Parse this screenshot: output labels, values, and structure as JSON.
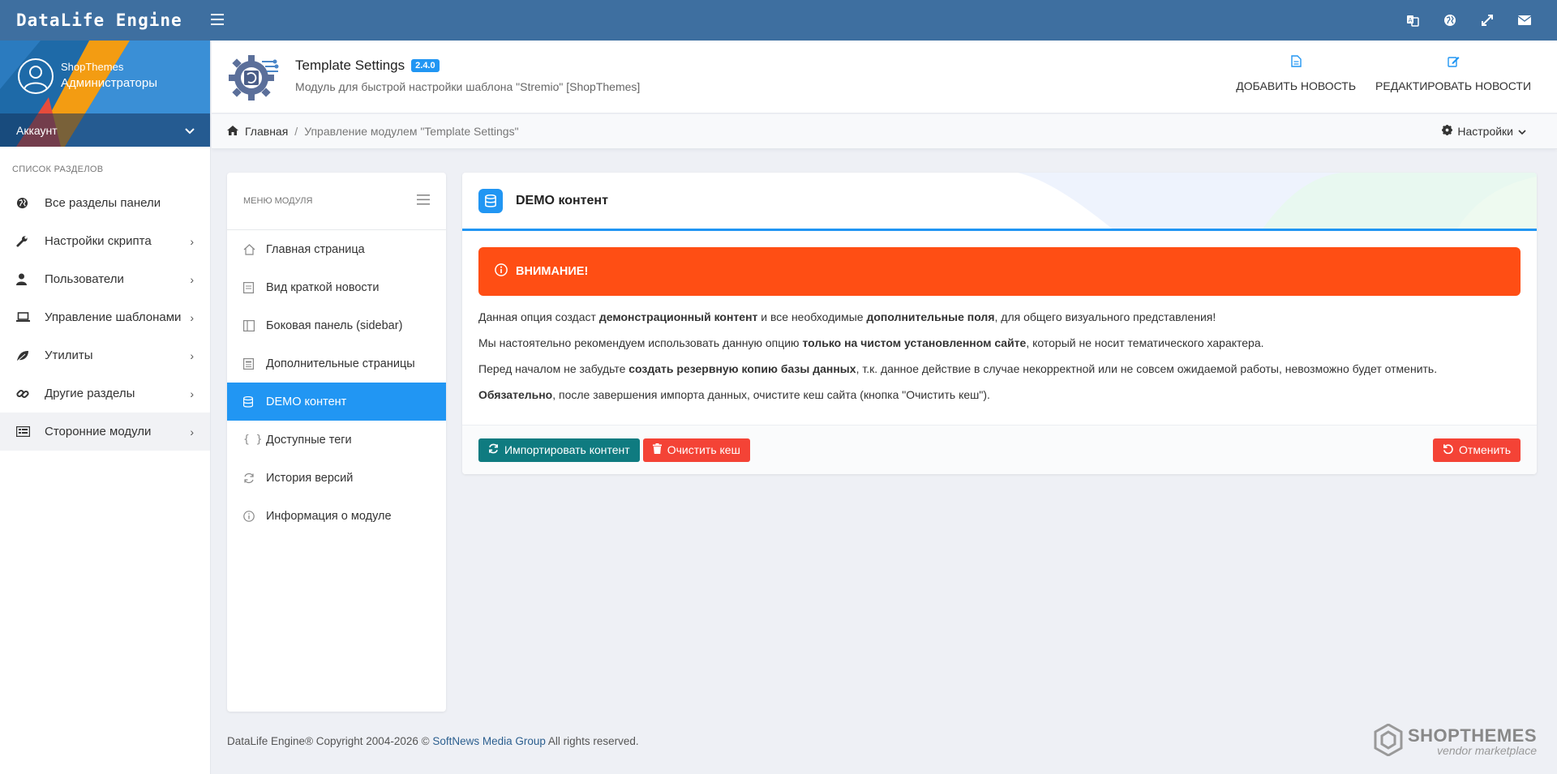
{
  "brand": "DataLife Engine",
  "user": {
    "name": "ShopThemes",
    "role": "Администраторы",
    "account_label": "Аккаунт"
  },
  "nav": {
    "heading": "Список разделов",
    "items": [
      {
        "label": "Все разделы панели",
        "icon": "globe-icon"
      },
      {
        "label": "Настройки скрипта",
        "icon": "wrench-icon"
      },
      {
        "label": "Пользователи",
        "icon": "user-icon"
      },
      {
        "label": "Управление шаблонами",
        "icon": "laptop-icon"
      },
      {
        "label": "Утилиты",
        "icon": "leaf-icon"
      },
      {
        "label": "Другие разделы",
        "icon": "link-icon"
      },
      {
        "label": "Сторонние модули",
        "icon": "modules-icon"
      }
    ]
  },
  "header": {
    "title": "Template Settings",
    "version": "2.4.0",
    "subtitle": "Модуль для быстрой настройки шаблона \"Stremio\" [ShopThemes]",
    "add_news": "Добавить новость",
    "edit_news": "Редактировать новости"
  },
  "breadcrumb": {
    "home": "Главная",
    "current": "Управление модулем \"Template Settings\"",
    "settings": "Настройки"
  },
  "module_menu": {
    "heading": "Меню модуля",
    "items": [
      {
        "label": "Главная страница"
      },
      {
        "label": "Вид краткой новости"
      },
      {
        "label": "Боковая панель (sidebar)"
      },
      {
        "label": "Дополнительные страницы"
      },
      {
        "label": "DEMO контент"
      },
      {
        "label": "Доступные теги"
      },
      {
        "label": "История версий"
      },
      {
        "label": "Информация о модуле"
      }
    ],
    "active_index": 4
  },
  "content": {
    "title": "DEMO контент",
    "alert": "ВНИМАНИЕ!",
    "p1_a": "Данная опция создаст ",
    "p1_b": "демонстрационный контент",
    "p1_c": " и все необходимые ",
    "p1_d": "дополнительные поля",
    "p1_e": ", для общего визуального представления!",
    "p2_a": "Мы настоятельно рекомендуем использовать данную опцию ",
    "p2_b": "только на чистом установленном сайте",
    "p2_c": ", который не носит тематического характера.",
    "p3_a": "Перед началом не забудьте ",
    "p3_b": "создать резервную копию базы данных",
    "p3_c": ", т.к. данное действие в случае некорректной или не совсем ожидаемой работы, невозможно будет отменить.",
    "p4_a": "Обязательно",
    "p4_b": ", после завершения импорта данных, очистите кеш сайта (кнопка \"Очистить кеш\").",
    "btn_import": "Импортировать контент",
    "btn_clear": "Очистить кеш",
    "btn_cancel": "Отменить"
  },
  "footer": {
    "text_a": "DataLife Engine® Copyright 2004-2026 © ",
    "link": "SoftNews Media Group",
    "text_b": " All rights reserved."
  },
  "shop_logo": {
    "line1": "SHOPTHEMES",
    "line2": "vendor marketplace"
  },
  "colors": {
    "topbar": "#3e6fa0",
    "accent": "#2196f3",
    "alert": "#ff4e14",
    "teal": "#0f7b80",
    "red": "#f44336"
  }
}
